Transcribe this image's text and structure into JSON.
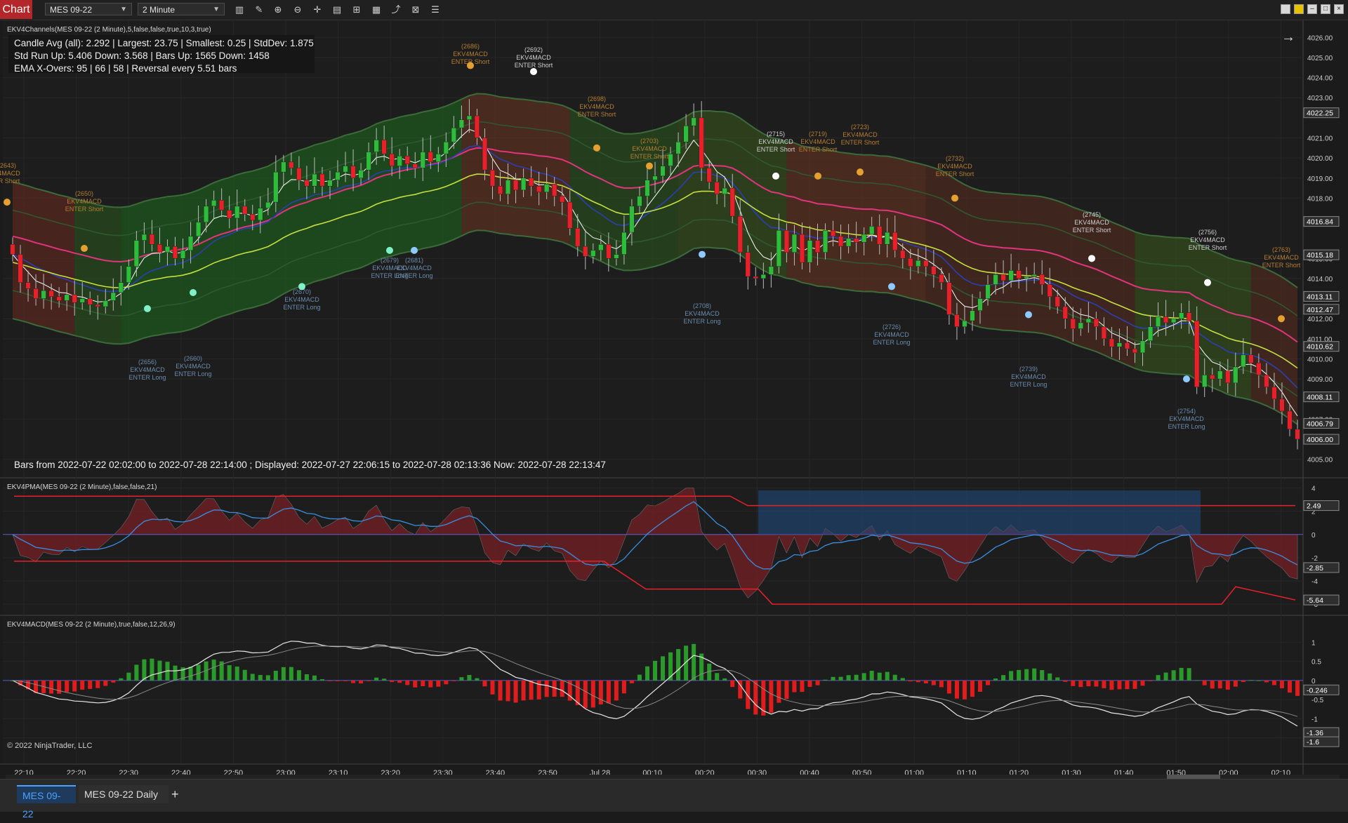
{
  "toolbar": {
    "chart_label": "Chart",
    "instrument": "MES 09-22",
    "interval": "2 Minute",
    "icons": [
      "bar-style-icon",
      "drawing-tools-icon",
      "zoom-in-icon",
      "zoom-out-icon",
      "crosshair-icon",
      "data-box-icon",
      "chart-trader-icon",
      "templates-icon",
      "strategies-icon",
      "indicators-icon",
      "properties-icon"
    ]
  },
  "window_controls": [
    "minimize",
    "restore",
    "maximize",
    "close"
  ],
  "panel1": {
    "title": "EKV4Channels(MES 09-22 (2 Minute),5,false,false,true,10,3,true)",
    "stats_line1": "Candle Avg (all): 2.292 | Largest: 23.75 | Smallest: 0.25 |  StdDev: 1.875",
    "stats_line2": "Std Run Up: 5.406 Down: 3.568   |   Bars Up: 1565 Down: 1458",
    "stats_line3": "EMA X-Overs:  95   |   66   |   58   |   Reversal every 5.51 bars",
    "bars_info": "Bars from 2022-07-22 02:02:00 to 2022-07-28 22:14:00 ;  Displayed: 2022-07-27 22:06:15 to 2022-07-28 02:13:36 Now: 2022-07-28 22:13:47",
    "price_ticks": [
      "4026.00",
      "4025.00",
      "4024.00",
      "4023.00",
      "4021.00",
      "4020.00",
      "4019.00",
      "4018.00",
      "4015.00",
      "4014.00",
      "4012.00",
      "4011.00",
      "4010.00",
      "4009.00",
      "4007.00",
      "4005.00"
    ],
    "price_markers": [
      {
        "label": "4022.25",
        "color": "#3a3a3a"
      },
      {
        "label": "4016.84",
        "color": "#3a3a3a"
      },
      {
        "label": "4015.18",
        "color": "#3a3a3a"
      },
      {
        "label": "4013.11",
        "color": "#3a3a3a"
      },
      {
        "label": "4012.47",
        "color": "#3a3a3a"
      },
      {
        "label": "4010.62",
        "color": "#3a3a3a"
      },
      {
        "label": "4008.11",
        "color": "#3a3a3a"
      },
      {
        "label": "4006.79",
        "color": "#3a3a3a"
      },
      {
        "label": "4006.00",
        "color": "#3a3a3a"
      }
    ],
    "signals": [
      {
        "id": "(2643)",
        "name": "V4MACD",
        "action": "ER Short",
        "type": "short"
      },
      {
        "id": "(2650)",
        "name": "EKV4MACD",
        "action": "ENTER Short",
        "type": "short"
      },
      {
        "id": "(2656)",
        "name": "EKV4MACD",
        "action": "ENTER Long",
        "type": "long"
      },
      {
        "id": "(2660)",
        "name": "EKV4MACD",
        "action": "ENTER Long",
        "type": "long"
      },
      {
        "id": "(2670)",
        "name": "EKV4MACD",
        "action": "ENTER Long",
        "type": "long"
      },
      {
        "id": "(2679)",
        "name": "EKV4MACD",
        "action": "ENTER Long",
        "type": "long"
      },
      {
        "id": "(2681)",
        "name": "EKV4MACD",
        "action": "ENTER Long",
        "type": "long"
      },
      {
        "id": "(2686)",
        "name": "EKV4MACD",
        "action": "ENTER Short",
        "type": "short"
      },
      {
        "id": "(2692)",
        "name": "EKV4MACD",
        "action": "ENTER Short",
        "type": "short-white"
      },
      {
        "id": "(2698)",
        "name": "EKV4MACD",
        "action": "ENTER Short",
        "type": "short"
      },
      {
        "id": "(2703)",
        "name": "EKV4MACD",
        "action": "ENTER Short",
        "type": "short"
      },
      {
        "id": "(2708)",
        "name": "EKV4MACD",
        "action": "ENTER Long",
        "type": "long"
      },
      {
        "id": "(2715)",
        "name": "EKV4MACD",
        "action": "ENTER Short",
        "type": "short-white"
      },
      {
        "id": "(2719)",
        "name": "EKV4MACD",
        "action": "ENTER Short",
        "type": "short"
      },
      {
        "id": "(2723)",
        "name": "EKV4MACD",
        "action": "ENTER Short",
        "type": "short"
      },
      {
        "id": "(2726)",
        "name": "EKV4MACD",
        "action": "ENTER Long",
        "type": "long"
      },
      {
        "id": "(2732)",
        "name": "EKV4MACD",
        "action": "ENTER Short",
        "type": "short"
      },
      {
        "id": "(2739)",
        "name": "EKV4MACD",
        "action": "ENTER Long",
        "type": "long"
      },
      {
        "id": "(2745)",
        "name": "EKV4MACD",
        "action": "ENTER Short",
        "type": "short-white"
      },
      {
        "id": "(2754)",
        "name": "EKV4MACD",
        "action": "ENTER Long",
        "type": "long"
      },
      {
        "id": "(2756)",
        "name": "EKV4MACD",
        "action": "ENTER Short",
        "type": "short-white"
      },
      {
        "id": "(2763)",
        "name": "EKV4MACD",
        "action": "ENTER Short",
        "type": "short"
      }
    ]
  },
  "panel2": {
    "title": "EKV4PMA(MES 09-22 (2 Minute),false,false,21)",
    "ticks": [
      "4",
      "2",
      "0",
      "-2",
      "-4",
      "-6"
    ],
    "markers": [
      "2.49",
      "-2.85",
      "-5.64"
    ]
  },
  "panel3": {
    "title": "EKV4MACD(MES 09-22 (2 Minute),true,false,12,26,9)",
    "ticks": [
      "1",
      "0.5",
      "0",
      "-0.5",
      "-1",
      "-1.5"
    ],
    "markers": [
      "-0.246",
      "-1.36",
      "-1.6"
    ],
    "copyright": "© 2022 NinjaTrader, LLC"
  },
  "time_axis": [
    "22:10",
    "22:20",
    "22:30",
    "22:40",
    "22:50",
    "23:00",
    "23:10",
    "23:20",
    "23:30",
    "23:40",
    "23:50",
    "Jul 28",
    "00:10",
    "00:20",
    "00:30",
    "00:40",
    "00:50",
    "01:00",
    "01:10",
    "01:20",
    "01:30",
    "01:40",
    "01:50",
    "02:00",
    "02:10"
  ],
  "tabs": {
    "active": "MES 09-22",
    "other": "MES 09-22 Daily",
    "add": "+"
  },
  "colors": {
    "up_candle": "#2ebd3a",
    "down_candle": "#e8202a",
    "ema_pink": "#e0357e",
    "ema_blue": "#2b3fb0",
    "ema_yellow": "#c6e040",
    "short_text": "#b77d32",
    "long_text": "#6a8cb0"
  },
  "chart_data": {
    "type": "candlestick",
    "x_range": [
      "22:06",
      "02:14"
    ],
    "ylim": [
      4004.5,
      4026.5
    ],
    "close": [
      4015.2,
      4013.8,
      4013.5,
      4013.0,
      4013.4,
      4013.1,
      4012.9,
      4013.2,
      4012.8,
      4013.0,
      4012.7,
      4012.6,
      4012.9,
      4013.3,
      4013.8,
      4014.6,
      4015.9,
      4016.2,
      4015.7,
      4015.3,
      4015.6,
      4015.0,
      4015.4,
      4016.1,
      4016.8,
      4017.6,
      4017.9,
      4017.4,
      4017.0,
      4017.6,
      4017.2,
      4016.9,
      4017.5,
      4017.8,
      4019.3,
      4019.8,
      4019.5,
      4018.9,
      4018.6,
      4019.2,
      4018.6,
      4018.9,
      4019.3,
      4019.6,
      4019.0,
      4019.4,
      4020.3,
      4020.9,
      4020.2,
      4019.6,
      4020.1,
      4019.7,
      4019.5,
      4020.3,
      4019.8,
      4020.2,
      4020.8,
      4021.5,
      4021.9,
      4022.1,
      4021.0,
      4019.4,
      4018.6,
      4018.2,
      4018.9,
      4018.4,
      4019.0,
      4018.6,
      4018.3,
      4018.7,
      4018.1,
      4017.8,
      4016.5,
      4015.6,
      4015.1,
      4015.4,
      4015.7,
      4015.0,
      4015.2,
      4016.3,
      4017.6,
      4018.1,
      4018.9,
      4019.1,
      4019.6,
      4020.2,
      4020.8,
      4021.6,
      4022.0,
      4019.5,
      4018.8,
      4018.2,
      4018.5,
      4017.1,
      4015.3,
      4014.1,
      4014.0,
      4014.2,
      4014.6,
      4016.4,
      4015.3,
      4016.2,
      4014.8,
      4015.9,
      4015.3,
      4016.4,
      4016.1,
      4015.6,
      4016.0,
      4015.8,
      4016.2,
      4016.6,
      4015.7,
      4016.3,
      4015.4,
      4015.0,
      4014.6,
      4014.9,
      4014.6,
      4014.2,
      4013.8,
      4012.2,
      4011.6,
      4011.9,
      4012.4,
      4013.0,
      4013.7,
      4014.2,
      4013.9,
      4014.4,
      4014.0,
      4014.1,
      4014.2,
      4013.7,
      4013.1,
      4012.6,
      4012.0,
      4011.5,
      4011.8,
      4012.0,
      4011.6,
      4011.0,
      4010.6,
      4010.8,
      4010.5,
      4010.3,
      4010.9,
      4011.6,
      4012.1,
      4011.8,
      4012.0,
      4012.3,
      4011.9,
      4008.6,
      4009.2,
      4009.0,
      4009.4,
      4008.8,
      4009.6,
      4010.2,
      4009.8,
      4009.2,
      4008.6,
      4008.0,
      4007.4,
      4006.5,
      4006.0
    ]
  }
}
